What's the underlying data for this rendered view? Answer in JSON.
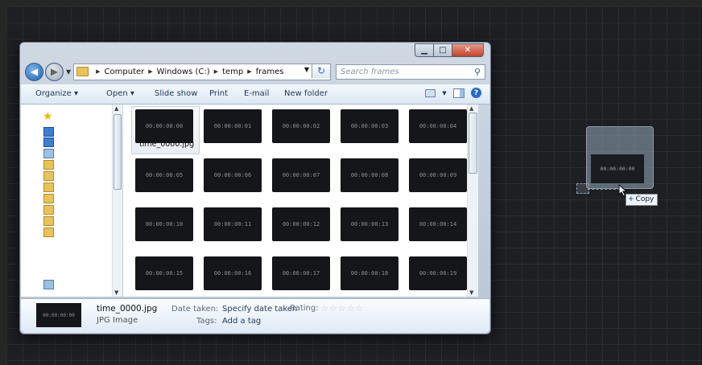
{
  "address": {
    "crumbs": [
      "Computer",
      "Windows (C:)",
      "temp",
      "frames"
    ],
    "search_placeholder": "Search frames"
  },
  "toolbar": {
    "organize": "Organize ▾",
    "open": "Open ▾",
    "slideshow": "Slide show",
    "print": "Print",
    "email": "E-mail",
    "new_folder": "New folder"
  },
  "thumbnails": [
    "00:00:00:00",
    "00:00:00:01",
    "00:00:00:02",
    "00:00:00:03",
    "00:00:00:04",
    "00:00:00:05",
    "00:00:00:06",
    "00:00:00:07",
    "00:00:00:08",
    "00:00:00:09",
    "00:00:00:10",
    "00:00:00:11",
    "00:00:00:12",
    "00:00:00:13",
    "00:00:00:14",
    "00:00:00:15",
    "00:00:00:16",
    "00:00:00:17",
    "00:00:00:18",
    "00:00:00:19"
  ],
  "selected_label": "time_0000.jpg",
  "details": {
    "thumb_text": "00:00:00:00",
    "name": "time_0000.jpg",
    "type": "JPG Image",
    "date_taken_label": "Date taken:",
    "date_taken_value": "Specify date taken",
    "tags_label": "Tags:",
    "tags_value": "Add a tag",
    "rating_label": "Rating:",
    "rating_stars": "☆☆☆☆☆"
  },
  "drag": {
    "thumb_text": "00:00:00:00",
    "tooltip": "Copy"
  },
  "colors": {
    "canvas": "#1e1f23",
    "thumb_bg": "#15161a",
    "accent": "#2a6cc0"
  }
}
